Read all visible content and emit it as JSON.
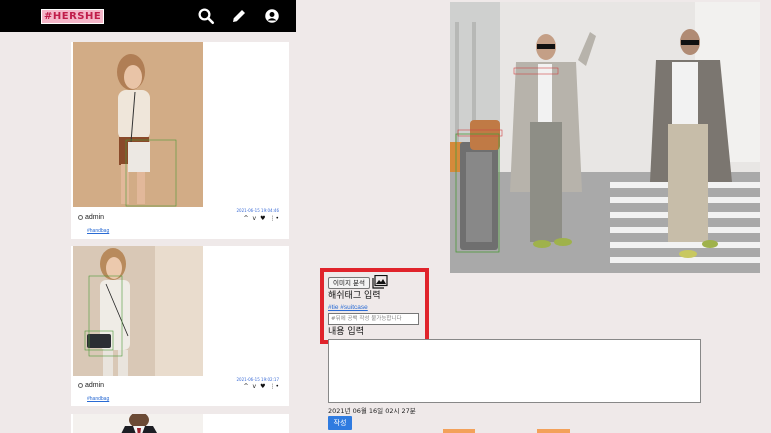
{
  "app": {
    "logo": "#HERSHE",
    "icons": [
      "search-icon",
      "pencil-icon",
      "account-icon"
    ]
  },
  "feed": {
    "posts": [
      {
        "time": "2021-06-15 19:04:46",
        "author": "admin",
        "tag": "#handbag"
      },
      {
        "time": "2021-06-15 19:02:17",
        "author": "admin",
        "tag": "#handbag"
      }
    ],
    "actions": [
      "^",
      "v",
      "♥",
      "⋮•"
    ]
  },
  "editor": {
    "analyze_label": "이미지 분석",
    "hashtag_label": "해쉬태그 입력",
    "tags_text": "#tie #suitcase",
    "hashtag_placeholder": "#뒤에 공백 작성 불가능합니다",
    "content_label": "내용 입력",
    "date_text": "2021년 06월 16일 02시 27분",
    "submit_label": "작성"
  },
  "colors": {
    "accent": "#2f7be0",
    "annotation": "#e0232b",
    "logo_bg": "#f4b6c8",
    "logo_text": "#c01d4a"
  }
}
